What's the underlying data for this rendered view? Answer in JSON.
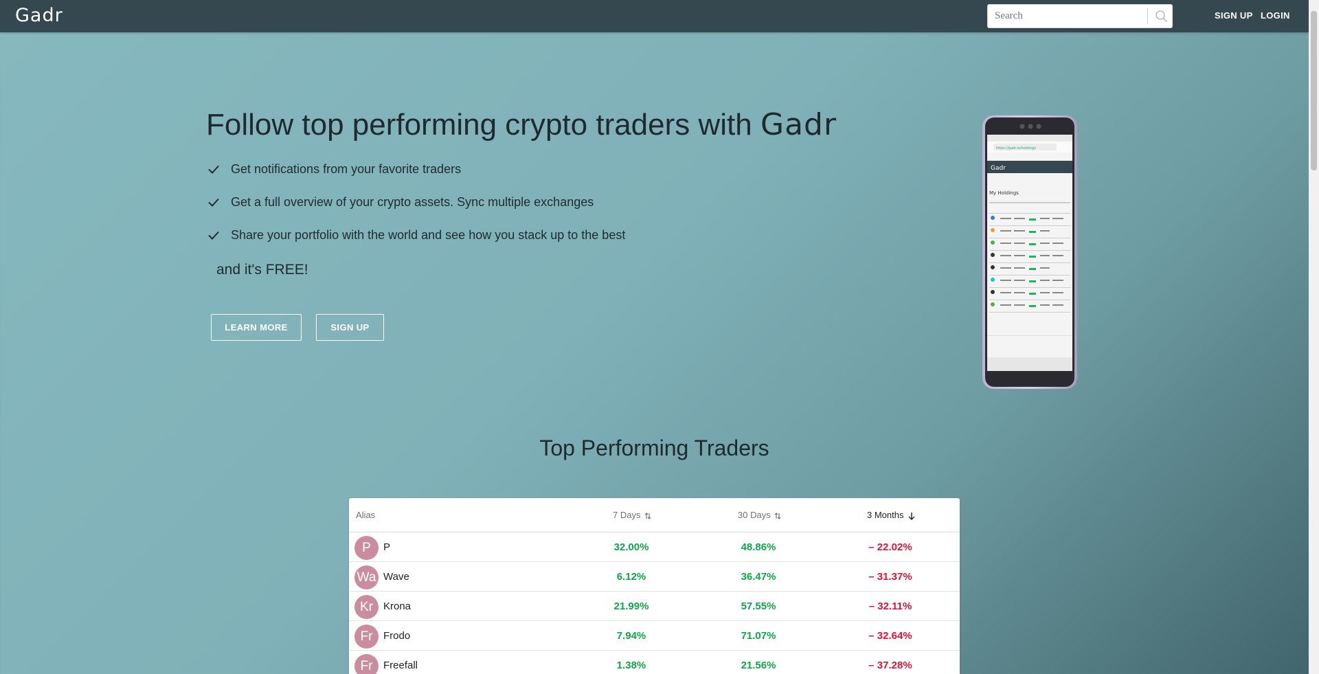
{
  "header": {
    "logo": "Gadr",
    "search_placeholder": "Search",
    "signup_label": "SIGN UP",
    "login_label": "LOGIN"
  },
  "hero": {
    "title_prefix": "Follow top performing crypto traders with ",
    "title_brand": "Gadr",
    "features": [
      "Get notifications from your favorite traders",
      "Get a full overview of your crypto assets. Sync multiple exchanges",
      "Share your portfolio with the world and see how you stack up to the best"
    ],
    "free_text": "and it's FREE!",
    "learn_more_label": "LEARN MORE",
    "signup_label": "SIGN UP"
  },
  "phone_screen": {
    "url": "https://gadr.io/holdings",
    "app_logo": "Gadr",
    "heading": "My Holdings"
  },
  "traders": {
    "title": "Top Performing Traders",
    "columns": {
      "alias": "Alias",
      "d7": "7 Days",
      "d30": "30 Days",
      "m3": "3 Months"
    },
    "rows": [
      {
        "initials": "P",
        "alias": "P",
        "d7": "32.00%",
        "d30": "48.86%",
        "m3": "– 22.02%"
      },
      {
        "initials": "Wa",
        "alias": "Wave",
        "d7": "6.12%",
        "d30": "36.47%",
        "m3": "– 31.37%"
      },
      {
        "initials": "Kr",
        "alias": "Krona",
        "d7": "21.99%",
        "d30": "57.55%",
        "m3": "– 32.11%"
      },
      {
        "initials": "Fr",
        "alias": "Frodo",
        "d7": "7.94%",
        "d30": "71.07%",
        "m3": "– 32.64%"
      },
      {
        "initials": "Fr",
        "alias": "Freefall",
        "d7": "1.38%",
        "d30": "21.56%",
        "m3": "– 37.28%"
      }
    ]
  },
  "colors": {
    "topbar": "#35474f",
    "positive": "#0ea64b",
    "negative": "#e01236",
    "avatar": "#c98d9f"
  }
}
